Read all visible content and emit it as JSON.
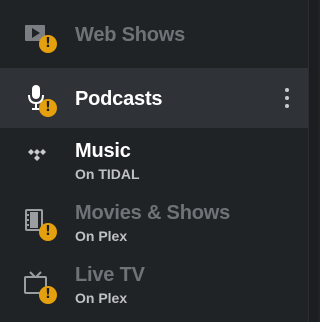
{
  "sidebar": {
    "items": [
      {
        "title": "Web Shows",
        "subtitle": "",
        "icon": "web-shows-icon",
        "warning": "!"
      },
      {
        "title": "Podcasts",
        "subtitle": "",
        "icon": "microphone-icon",
        "warning": "!"
      },
      {
        "title": "Music",
        "subtitle": "On TIDAL",
        "icon": "tidal-icon",
        "warning": ""
      },
      {
        "title": "Movies & Shows",
        "subtitle": "On Plex",
        "icon": "film-icon",
        "warning": "!"
      },
      {
        "title": "Live TV",
        "subtitle": "On Plex",
        "icon": "tv-icon",
        "warning": "!"
      }
    ]
  },
  "colors": {
    "background": "#202326",
    "selected": "#2f3338",
    "warning": "#e5a00d",
    "dim_text": "#6f7378"
  }
}
